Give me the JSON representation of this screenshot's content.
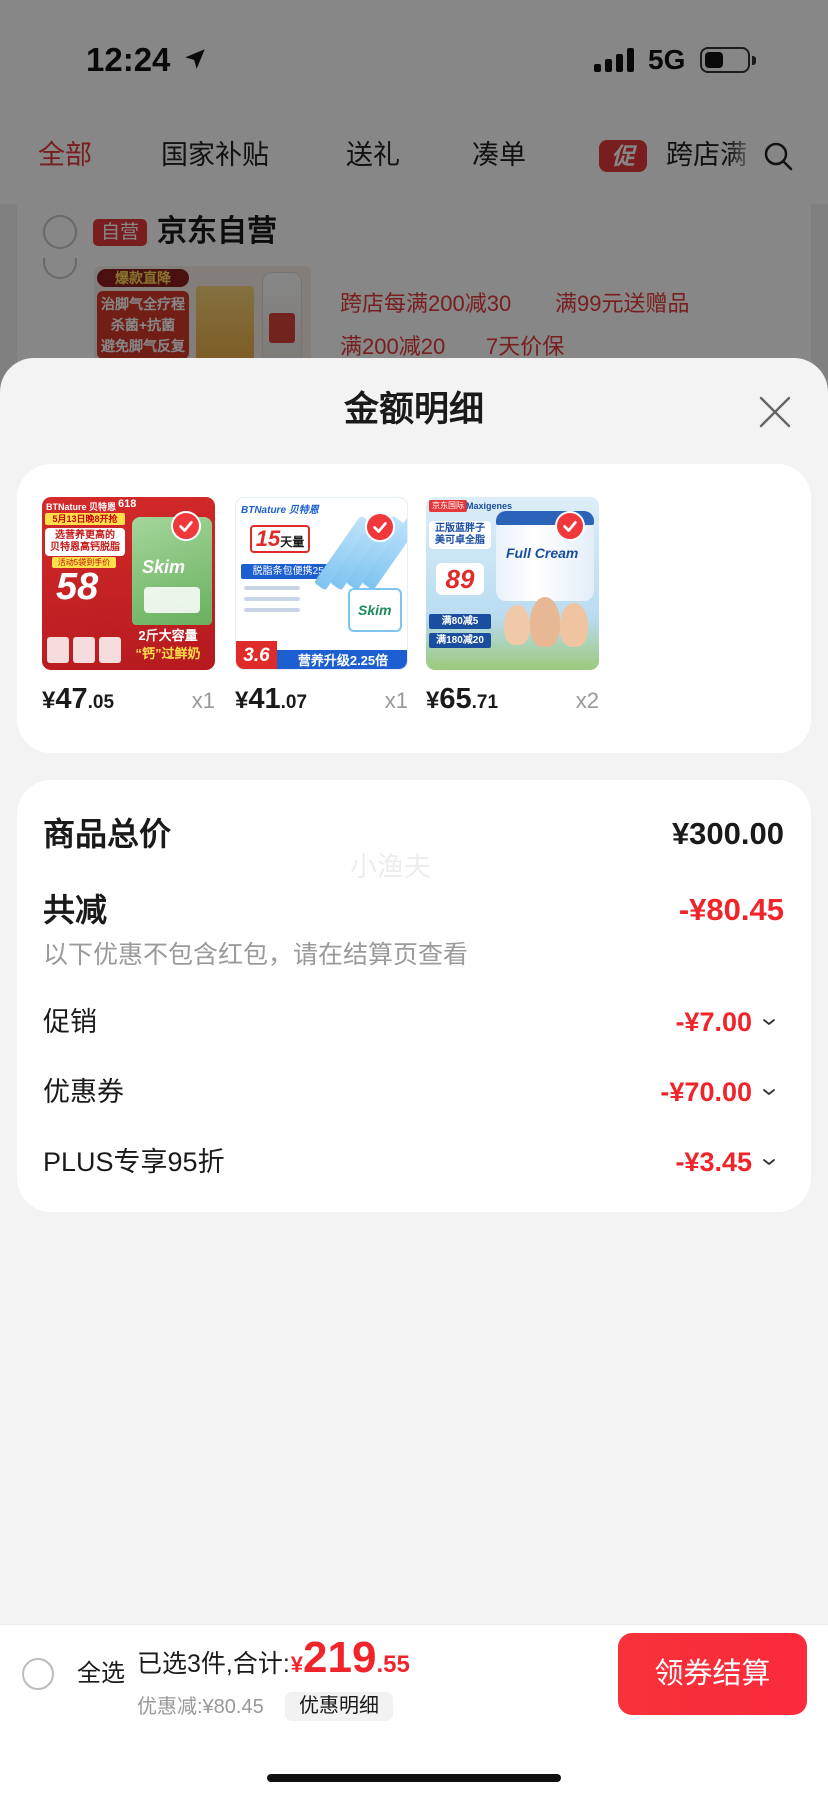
{
  "colors": {
    "accent": "#e4393c",
    "price_red": "#f0252b",
    "button_red": "#f7323a",
    "button_red_2": "#fb2a3c"
  },
  "status_bar": {
    "time": "12:24",
    "network": "5G",
    "battery_level": 0.45,
    "icons": [
      "location-arrow-icon",
      "signal-icon",
      "battery-icon"
    ]
  },
  "background_page": {
    "tabs": [
      {
        "label": "全部"
      },
      {
        "label": "国家补贴"
      },
      {
        "label": "送礼"
      },
      {
        "label": "凑单"
      }
    ],
    "active_tab": "全部",
    "promo_badge": "促",
    "promo_tab": "跨店满",
    "store": {
      "badge": "自营",
      "name": "京东自营"
    },
    "product": {
      "image": {
        "tag": "爆款直降",
        "lines": [
          "治脚气全疗程",
          "杀菌+抗菌",
          "避免脚气反复"
        ]
      },
      "promos_row_1": [
        "跨店每满200减30",
        "满99元送赠品"
      ],
      "promos_row_2": [
        "满200减20",
        "7天价保"
      ]
    }
  },
  "sheet": {
    "title": "金额明细",
    "items": [
      {
        "currency": "¥",
        "integer": "47",
        "decimal": ".05",
        "qty": "x1",
        "selected": true,
        "image": {
          "brand": "BTNature 贝特恩",
          "event": "618",
          "date": "5月13日晚8开抢",
          "headline": [
            "选营养更高的",
            "贝特恩高钙脱脂"
          ],
          "price_label": "活动5袋到手价",
          "price": "58",
          "bag_label": "Skim",
          "footer": [
            "2斤大容量",
            "“钙”过鲜奶"
          ]
        }
      },
      {
        "currency": "¥",
        "integer": "41",
        "decimal": ".07",
        "qty": "x1",
        "selected": true,
        "image": {
          "brand": "BTNature 贝特恩",
          "headline_num": "15",
          "headline_unit": "天量",
          "banner": "脱脂条包便携25g",
          "jar_label": "Skim",
          "price": "3.6",
          "footer": "营养升级2.25倍"
        }
      },
      {
        "currency": "¥",
        "integer": "65",
        "decimal": ".71",
        "qty": "x2",
        "selected": true,
        "image": {
          "badge": "京东国际",
          "brand": "Maxigenes",
          "headline": [
            "正版蓝胖子",
            "美可卓全脂"
          ],
          "price": "89",
          "can_label": "Full Cream",
          "promos": [
            "满80减5",
            "满180减20"
          ]
        }
      }
    ],
    "summary": {
      "total_label": "商品总价",
      "total_value": "¥300.00",
      "discount_label": "共减",
      "discount_value": "-¥80.45",
      "note": "以下优惠不包含红包，请在结算页查看",
      "rows": [
        {
          "label": "促销",
          "value": "-¥7.00"
        },
        {
          "label": "优惠券",
          "value": "-¥70.00"
        },
        {
          "label": "PLUS专享95折",
          "value": "-¥3.45"
        }
      ]
    },
    "watermark": "小渔夫"
  },
  "bottom_bar": {
    "select_all": "全选",
    "selected_summary": "已选3件,合计:",
    "total_currency": "¥",
    "total_integer": "219",
    "total_decimal": ".55",
    "discount_text": "优惠减:¥80.45",
    "detail_chip": "优惠明细",
    "checkout_button": "领券结算"
  }
}
